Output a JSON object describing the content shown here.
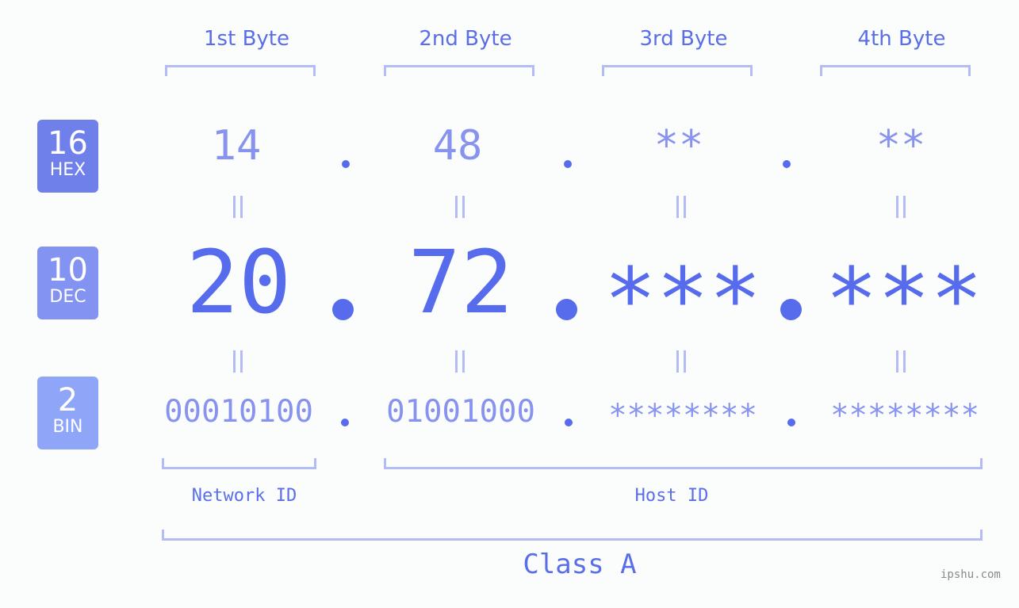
{
  "headers": [
    "1st Byte",
    "2nd Byte",
    "3rd Byte",
    "4th Byte"
  ],
  "rows": {
    "hex": {
      "badge_num": "16",
      "badge_label": "HEX",
      "values": [
        "14",
        "48",
        "**",
        "**"
      ],
      "color": "#7080ea"
    },
    "dec": {
      "badge_num": "10",
      "badge_label": "DEC",
      "values": [
        "20",
        "72",
        "***",
        "***"
      ],
      "color": "#8393f1"
    },
    "bin": {
      "badge_num": "2",
      "badge_label": "BIN",
      "values": [
        "00010100",
        "01001000",
        "********",
        "********"
      ],
      "color": "#8fa6f8"
    }
  },
  "segments": {
    "network": "Network ID",
    "host": "Host ID"
  },
  "class_label": "Class A",
  "watermark": "ipshu.com",
  "colors": {
    "accent": "#566ced",
    "light_value": "#8793ee",
    "bracket": "#b3bcf5",
    "background": "#fbfdfc"
  }
}
